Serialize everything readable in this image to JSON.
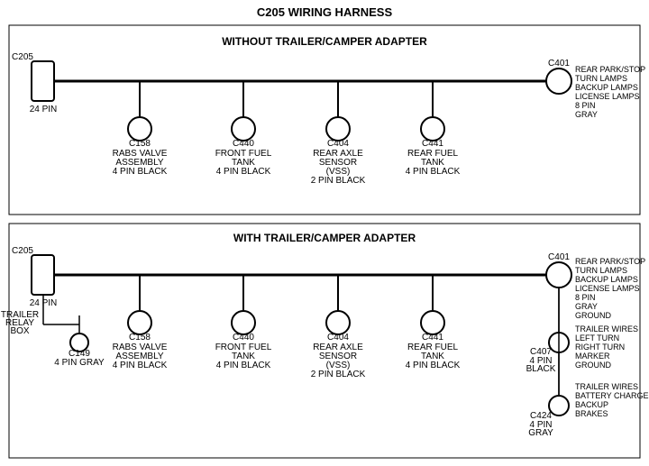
{
  "title": "C205 WIRING HARNESS",
  "section1": {
    "label": "WITHOUT TRAILER/CAMPER ADAPTER",
    "left_connector": {
      "id": "C205",
      "pins": "24 PIN",
      "shape": "rect"
    },
    "right_connector": {
      "id": "C401",
      "pins": "8 PIN",
      "color": "GRAY",
      "shape": "circle"
    },
    "right_labels": [
      "REAR PARK/STOP",
      "TURN LAMPS",
      "BACKUP LAMPS",
      "LICENSE LAMPS"
    ],
    "connectors": [
      {
        "id": "C158",
        "line1": "RABS VALVE",
        "line2": "ASSEMBLY",
        "line3": "4 PIN BLACK"
      },
      {
        "id": "C440",
        "line1": "FRONT FUEL",
        "line2": "TANK",
        "line3": "4 PIN BLACK"
      },
      {
        "id": "C404",
        "line1": "REAR AXLE",
        "line2": "SENSOR",
        "line3": "(VSS)",
        "line4": "2 PIN BLACK"
      },
      {
        "id": "C441",
        "line1": "REAR FUEL",
        "line2": "TANK",
        "line3": "4 PIN BLACK"
      }
    ]
  },
  "section2": {
    "label": "WITH TRAILER/CAMPER ADAPTER",
    "left_connector": {
      "id": "C205",
      "pins": "24 PIN",
      "shape": "rect"
    },
    "right_connector": {
      "id": "C401",
      "pins": "8 PIN",
      "color": "GRAY",
      "shape": "circle"
    },
    "right_labels": [
      "REAR PARK/STOP",
      "TURN LAMPS",
      "BACKUP LAMPS",
      "LICENSE LAMPS",
      "GROUND"
    ],
    "trailer_relay": {
      "label": "TRAILER",
      "label2": "RELAY",
      "label3": "BOX"
    },
    "c149": {
      "id": "C149",
      "pins": "4 PIN GRAY"
    },
    "connectors": [
      {
        "id": "C158",
        "line1": "RABS VALVE",
        "line2": "ASSEMBLY",
        "line3": "4 PIN BLACK"
      },
      {
        "id": "C440",
        "line1": "FRONT FUEL",
        "line2": "TANK",
        "line3": "4 PIN BLACK"
      },
      {
        "id": "C404",
        "line1": "REAR AXLE",
        "line2": "SENSOR",
        "line3": "(VSS)",
        "line4": "2 PIN BLACK"
      },
      {
        "id": "C441",
        "line1": "REAR FUEL",
        "line2": "TANK",
        "line3": "4 PIN BLACK"
      }
    ],
    "c407": {
      "id": "C407",
      "pins": "4 PIN",
      "color": "BLACK"
    },
    "c407_labels": [
      "TRAILER WIRES",
      "LEFT TURN",
      "RIGHT TURN",
      "MARKER",
      "GROUND"
    ],
    "c424": {
      "id": "C424",
      "pins": "4 PIN",
      "color": "GRAY"
    },
    "c424_labels": [
      "TRAILER WIRES",
      "BATTERY CHARGE",
      "BACKUP",
      "BRAKES"
    ]
  }
}
